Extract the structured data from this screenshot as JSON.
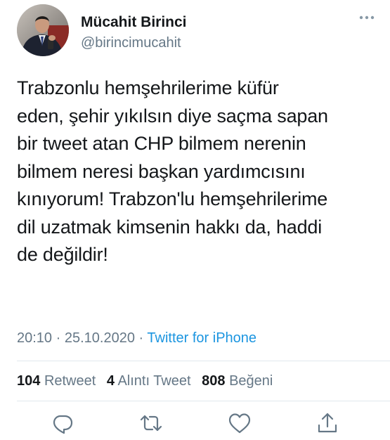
{
  "tweet": {
    "author": {
      "display_name": "Mücahit Birinci",
      "handle": "@birincimucahit",
      "avatar_icon": "profile-photo"
    },
    "text": "Trabzonlu hemşehrilerime küfür\neden, şehir yıkılsın diye saçma sapan\nbir tweet atan CHP bilmem nerenin\nbilmem neresi başkan yardımcısını\nkınıyorum! Trabzon'lu hemşehrilerime\ndil uzatmak kimsenin hakkı da, haddi\nde değildir!",
    "time": "20:10",
    "separator": "·",
    "date": "25.10.2020",
    "source": "Twitter for iPhone",
    "stats": {
      "retweets": {
        "count": "104",
        "label": "Retweet"
      },
      "quotes": {
        "count": "4",
        "label": "Alıntı Tweet"
      },
      "likes": {
        "count": "808",
        "label": "Beğeni"
      }
    },
    "actions": [
      "reply-icon",
      "retweet-icon",
      "like-icon",
      "share-icon"
    ]
  },
  "colors": {
    "text": "#14171a",
    "secondary": "#657786",
    "link": "#1b95e0",
    "divider": "#e1e8ed"
  }
}
